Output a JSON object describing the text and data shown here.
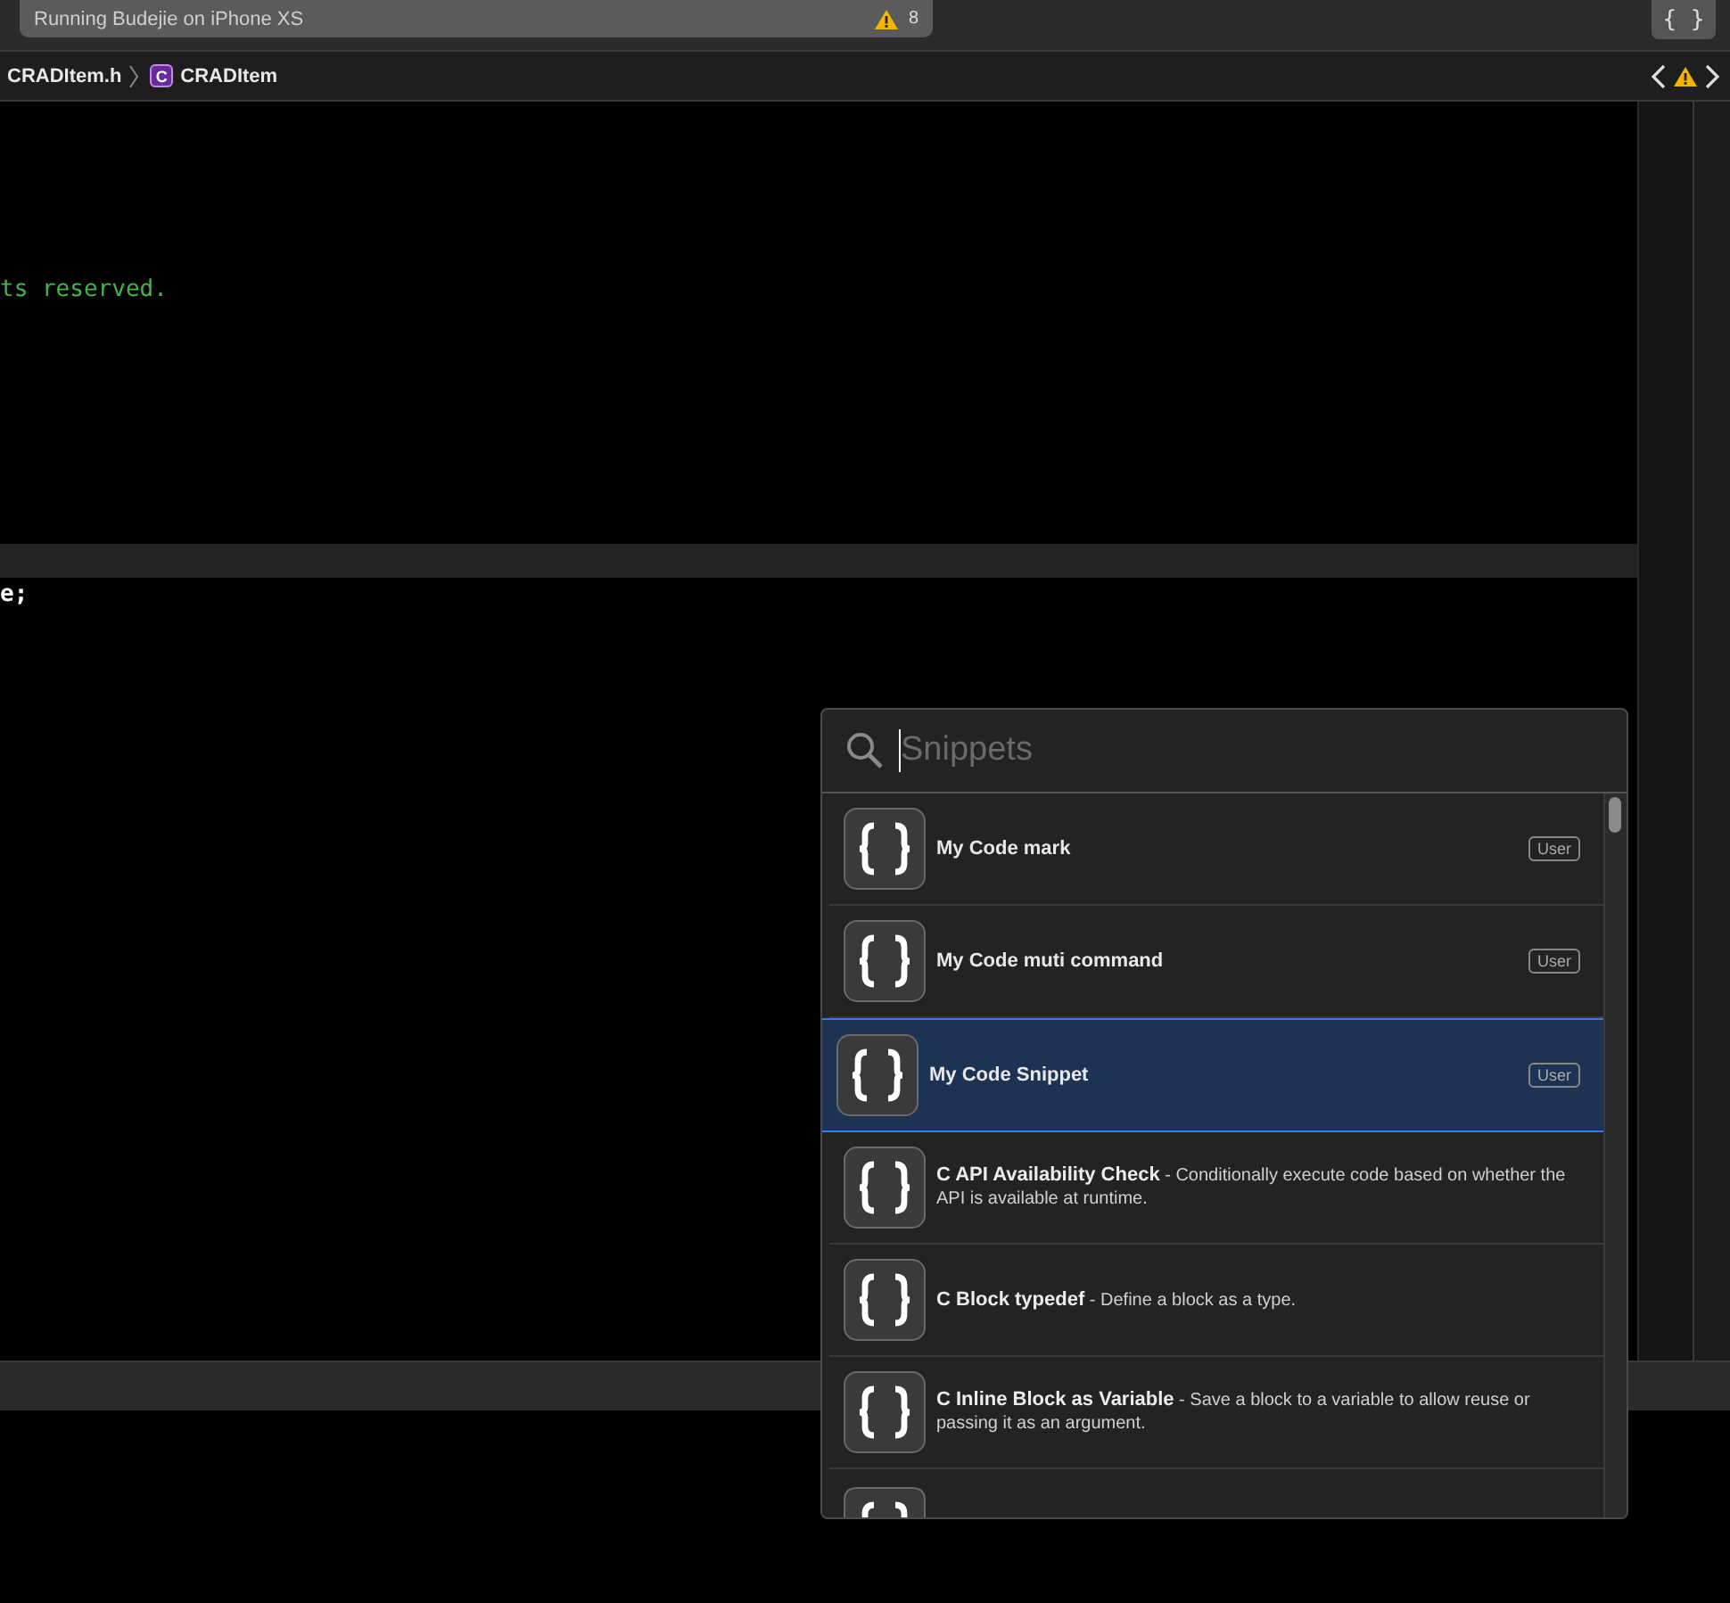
{
  "toolbar": {
    "activity": "Running Budejie on iPhone XS",
    "warning_count": "8",
    "library_button": "{ }"
  },
  "breadcrumb": {
    "file": "CRADItem.h",
    "class_badge": "C",
    "symbol": "CRADItem"
  },
  "editor": {
    "lines": [
      {
        "kind": "blank"
      },
      {
        "kind": "blank"
      },
      {
        "kind": "blank"
      },
      {
        "kind": "blank"
      },
      {
        "kind": "blank"
      },
      {
        "kind": "comment",
        "text": "ts reserved."
      },
      {
        "kind": "blank"
      },
      {
        "kind": "blank"
      },
      {
        "kind": "blank"
      },
      {
        "kind": "blank"
      },
      {
        "kind": "blank"
      },
      {
        "kind": "blank"
      },
      {
        "kind": "blank"
      },
      {
        "kind": "current"
      },
      {
        "kind": "code",
        "text": "e;"
      }
    ]
  },
  "snippet_library": {
    "search": {
      "placeholder": "Snippets"
    },
    "items": [
      {
        "kind": "user",
        "text": "**My Code mark**",
        "badge": "User",
        "selected": false
      },
      {
        "kind": "user",
        "text": "**My Code muti command**",
        "badge": "User",
        "selected": false
      },
      {
        "kind": "user",
        "text": "**My Code Snippet**",
        "badge": "User",
        "selected": true
      },
      {
        "kind": "system",
        "text": "**C API Availability Check** - Conditionally execute code based on whether the API is available at runtime.",
        "selected": false
      },
      {
        "kind": "system",
        "text": "**C Block typedef** - Define a block as a type.",
        "selected": false
      },
      {
        "kind": "system",
        "text": "**C Inline Block as Variable** - Save a block to a variable to allow reuse or passing it as an argument.",
        "selected": false
      }
    ]
  }
}
